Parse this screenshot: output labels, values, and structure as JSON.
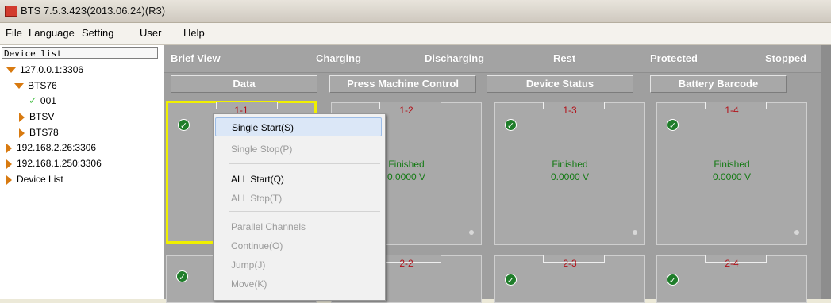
{
  "window": {
    "title": "BTS 7.5.3.423(2013.06.24)(R3)"
  },
  "menu": [
    "File",
    "Language",
    "Setting",
    "User",
    "Help"
  ],
  "sidebar": {
    "header": "Device list",
    "items": [
      {
        "label": "127.0.0.1:3306",
        "icon": "triangle-down-icon"
      },
      {
        "label": "BTS76",
        "icon": "triangle-down-icon"
      },
      {
        "label": "001",
        "icon": "checkmark-icon"
      },
      {
        "label": "BTSV",
        "icon": "triangle-right-icon"
      },
      {
        "label": "BTS78",
        "icon": "triangle-right-icon"
      },
      {
        "label": "192.168.2.26:3306",
        "icon": "triangle-right-icon"
      },
      {
        "label": "192.168.1.250:3306",
        "icon": "triangle-right-icon"
      },
      {
        "label": "Device List",
        "icon": "triangle-right-icon"
      }
    ]
  },
  "status_legend": [
    "Brief View",
    "Charging",
    "Discharging",
    "Rest",
    "Protected",
    "Stopped"
  ],
  "tabs": [
    "Data",
    "Press Machine Control",
    "Device Status",
    "Battery Barcode"
  ],
  "channels_row1": [
    {
      "id": "1-1",
      "status": "",
      "voltage": ""
    },
    {
      "id": "1-2",
      "status": "Finished",
      "voltage": "0.0000 V"
    },
    {
      "id": "1-3",
      "status": "Finished",
      "voltage": "0.0000 V"
    },
    {
      "id": "1-4",
      "status": "Finished",
      "voltage": "0.0000 V"
    }
  ],
  "channels_row2": [
    {
      "id": "",
      "status": "",
      "voltage": ""
    },
    {
      "id": "2-2",
      "status": "",
      "voltage": ""
    },
    {
      "id": "2-3",
      "status": "",
      "voltage": ""
    },
    {
      "id": "2-4",
      "status": "",
      "voltage": ""
    }
  ],
  "context_menu": [
    {
      "label": "Single Start(S)",
      "enabled": true,
      "highlighted": true
    },
    {
      "label": "Single Stop(P)",
      "enabled": false
    },
    {
      "label": "ALL Start(Q)",
      "enabled": true
    },
    {
      "label": "ALL Stop(T)",
      "enabled": false
    },
    {
      "label": "Parallel Channels",
      "enabled": false
    },
    {
      "label": "Continue(O)",
      "enabled": false
    },
    {
      "label": "Jump(J)",
      "enabled": false
    },
    {
      "label": "Move(K)",
      "enabled": false
    }
  ],
  "colors": {
    "channel_id": "#b2121a",
    "status_text": "#147a14",
    "selected_border": "#f0f000",
    "ok_badge": "#1f7d2a"
  }
}
